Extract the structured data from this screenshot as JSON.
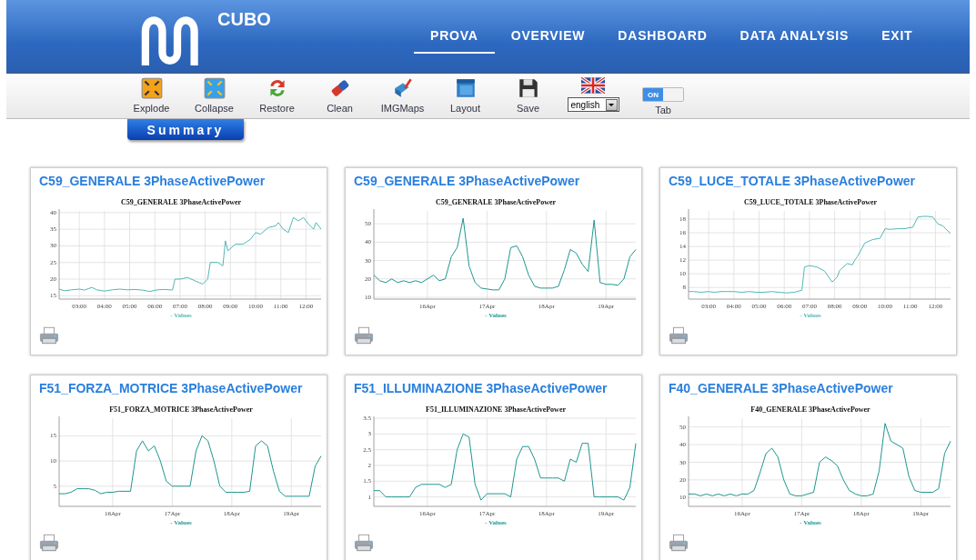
{
  "header": {
    "logo_text": "CUBO",
    "nav": [
      {
        "label": "PROVA",
        "selected": true
      },
      {
        "label": "OVERVIEW",
        "selected": false
      },
      {
        "label": "DASHBOARD",
        "selected": false
      },
      {
        "label": "DATA ANALYSIS",
        "selected": false
      },
      {
        "label": "EXIT",
        "selected": false
      }
    ]
  },
  "toolbar": {
    "buttons": [
      {
        "kind": "explode",
        "label": "Explode"
      },
      {
        "kind": "collapse",
        "label": "Collapse"
      },
      {
        "kind": "restore",
        "label": "Restore"
      },
      {
        "kind": "clean",
        "label": "Clean"
      },
      {
        "kind": "imgmaps",
        "label": "IMGMaps"
      },
      {
        "kind": "layout",
        "label": "Layout"
      },
      {
        "kind": "save",
        "label": "Save"
      }
    ],
    "language": {
      "value": "english"
    },
    "toggle": {
      "on": true,
      "text": "ON",
      "label": "Tab"
    }
  },
  "summary_tab": {
    "label": "Summary"
  },
  "cards": [
    {
      "title": "C59_GENERALE 3PhaseActivePower",
      "chart_data": {
        "type": "line",
        "grid": true,
        "title": "C59_GENERALE 3PhaseActivePower",
        "xlim": [
          2.2,
          12.6
        ],
        "ylim": [
          14,
          40.5
        ],
        "yticks": [
          15,
          20,
          25,
          30,
          35,
          40
        ],
        "xticks": [
          {
            "value": 3,
            "label": "03:00"
          },
          {
            "value": 4,
            "label": "04:00"
          },
          {
            "value": 5,
            "label": "05:00"
          },
          {
            "value": 6,
            "label": "06:00"
          },
          {
            "value": 7,
            "label": "07:00"
          },
          {
            "value": 8,
            "label": "08:00"
          },
          {
            "value": 9,
            "label": "09:00"
          },
          {
            "value": 10,
            "label": "10:00"
          },
          {
            "value": 11,
            "label": "11:00"
          },
          {
            "value": 12,
            "label": "12:00"
          }
        ],
        "x": [
          2.2,
          2.4,
          2.7,
          3.0,
          3.2,
          3.5,
          3.7,
          4.0,
          4.3,
          4.6,
          4.9,
          5.2,
          5.5,
          5.8,
          6.1,
          6.4,
          6.7,
          6.8,
          7.0,
          7.3,
          7.6,
          7.9,
          8.1,
          8.2,
          8.5,
          8.7,
          8.8,
          8.9,
          9.2,
          9.5,
          9.8,
          10.0,
          10.2,
          10.5,
          10.8,
          10.9,
          11.1,
          11.3,
          11.5,
          11.7,
          11.9,
          12.1,
          12.3,
          12.4,
          12.6
        ],
        "series": [
          {
            "name": "- Values",
            "color": "#52b8b4",
            "values": [
              17,
              16.5,
              16.8,
              17,
              16.7,
              17.5,
              16.8,
              16.4,
              16.8,
              17,
              16.8,
              16.9,
              16.7,
              16.3,
              16.8,
              16.9,
              16.7,
              20,
              20,
              20.5,
              19.5,
              18.5,
              20,
              25,
              25,
              24,
              31.5,
              28.5,
              30.5,
              30.5,
              32,
              34,
              33.5,
              35.5,
              36,
              37,
              35,
              34,
              38.5,
              37.5,
              38.5,
              36.5,
              35,
              37,
              35
            ]
          }
        ]
      }
    },
    {
      "title": "C59_GENERALE 3PhaseActivePower",
      "chart_data": {
        "type": "line",
        "grid": true,
        "title": "C59_GENERALE 3PhaseActivePower",
        "ylim": [
          9,
          57
        ],
        "yticks": [
          10,
          20,
          30,
          40,
          50
        ],
        "categories": [
          null,
          null,
          null,
          null,
          null,
          null,
          null,
          null,
          null,
          "16Apr",
          null,
          null,
          null,
          null,
          null,
          null,
          null,
          null,
          null,
          "17Apr",
          null,
          null,
          null,
          null,
          null,
          null,
          null,
          null,
          null,
          "18Apr",
          null,
          null,
          null,
          null,
          null,
          null,
          null,
          null,
          null,
          "19Apr",
          null,
          null,
          null,
          null,
          null
        ],
        "series": [
          {
            "name": "- Values",
            "color": "#1f9690",
            "values": [
              22,
              19,
              18,
              20,
              18,
              19,
              18,
              19,
              18,
              20,
              22,
              19,
              20,
              32,
              37,
              53,
              27,
              18,
              15,
              14.5,
              14,
              14,
              20,
              37,
              38,
              32,
              22,
              16,
              15,
              15,
              15,
              16,
              25,
              36,
              34,
              28,
              24,
              52,
              18,
              17,
              17,
              16.5,
              20,
              32,
              36
            ]
          }
        ]
      }
    },
    {
      "title": "C59_LUCE_TOTALE 3PhaseActivePower",
      "chart_data": {
        "type": "line",
        "grid": true,
        "title": "C59_LUCE_TOTALE 3PhaseActivePower",
        "xlim": [
          2.2,
          12.6
        ],
        "ylim": [
          6.3,
          19.2
        ],
        "yticks": [
          8,
          10,
          12,
          14,
          16,
          18
        ],
        "xticks": [
          {
            "value": 3,
            "label": "03:00"
          },
          {
            "value": 4,
            "label": "04:00"
          },
          {
            "value": 5,
            "label": "05:00"
          },
          {
            "value": 6,
            "label": "06:00"
          },
          {
            "value": 7,
            "label": "07:00"
          },
          {
            "value": 8,
            "label": "08:00"
          },
          {
            "value": 9,
            "label": "09:00"
          },
          {
            "value": 10,
            "label": "10:00"
          },
          {
            "value": 11,
            "label": "11:00"
          },
          {
            "value": 12,
            "label": "12:00"
          }
        ],
        "x": [
          2.2,
          2.4,
          2.7,
          3.0,
          3.2,
          3.5,
          3.7,
          4.0,
          4.3,
          4.6,
          4.9,
          5.2,
          5.5,
          5.8,
          6.1,
          6.4,
          6.7,
          6.8,
          7.0,
          7.3,
          7.6,
          7.9,
          8.1,
          8.2,
          8.5,
          8.7,
          8.8,
          8.9,
          9.2,
          9.5,
          9.8,
          10.0,
          10.2,
          10.5,
          10.8,
          10.9,
          11.1,
          11.3,
          11.5,
          11.7,
          11.9,
          12.1,
          12.3,
          12.4,
          12.6
        ],
        "series": [
          {
            "name": "- Values",
            "color": "#52b8b4",
            "values": [
              7.4,
              7.4,
              7.3,
              7.4,
              7.3,
              7.4,
              7.4,
              7.4,
              7.3,
              7.4,
              7.3,
              7.3,
              7.4,
              7.3,
              7.2,
              7.3,
              7.6,
              11,
              11.2,
              11,
              10.4,
              8.8,
              9.5,
              10.5,
              11.5,
              11.3,
              12,
              12.5,
              14.5,
              15,
              15.2,
              16.6,
              16.5,
              16.6,
              16.6,
              16.7,
              16.8,
              18.3,
              18.4,
              18.4,
              18.3,
              17.3,
              17,
              16.6,
              15.9
            ]
          }
        ]
      }
    },
    {
      "title": "F51_FORZA_MOTRICE 3PhaseActivePower",
      "chart_data": {
        "type": "line",
        "grid": true,
        "title": "F51_FORZA_MOTRICE 3PhaseActivePower",
        "ylim": [
          1,
          18.5
        ],
        "yticks": [
          5,
          10,
          15
        ],
        "categories": [
          null,
          null,
          null,
          null,
          null,
          null,
          null,
          null,
          null,
          "16Apr",
          null,
          null,
          null,
          null,
          null,
          null,
          null,
          null,
          null,
          "17Apr",
          null,
          null,
          null,
          null,
          null,
          null,
          null,
          null,
          null,
          "18Apr",
          null,
          null,
          null,
          null,
          null,
          null,
          null,
          null,
          null,
          "19Apr",
          null,
          null,
          null,
          null,
          null
        ],
        "series": [
          {
            "name": "- Values",
            "color": "#1f9690",
            "values": [
              3.5,
              3.5,
              3.8,
              4.5,
              4.5,
              4.5,
              4.2,
              3.5,
              3.8,
              3.8,
              4,
              4,
              4,
              12,
              14,
              12,
              13,
              10,
              6,
              5,
              5,
              5,
              5,
              12,
              15,
              14,
              10,
              5,
              3.8,
              3.8,
              3.8,
              3.8,
              4,
              13,
              14,
              13,
              8,
              4,
              3,
              3,
              3,
              3,
              3,
              9,
              11
            ]
          }
        ]
      }
    },
    {
      "title": "F51_ILLUMINAZIONE 3PhaseActivePower",
      "chart_data": {
        "type": "line",
        "grid": true,
        "title": "F51_ILLUMINAZIONE 3PhaseActivePower",
        "ylim": [
          0.7,
          3.5
        ],
        "yticks": [
          1,
          1.5,
          2,
          2.5,
          3,
          3.5
        ],
        "categories": [
          null,
          null,
          null,
          null,
          null,
          null,
          null,
          null,
          null,
          "16Apr",
          null,
          null,
          null,
          null,
          null,
          null,
          null,
          null,
          null,
          "17Apr",
          null,
          null,
          null,
          null,
          null,
          null,
          null,
          null,
          null,
          "18Apr",
          null,
          null,
          null,
          null,
          null,
          null,
          null,
          null,
          null,
          "19Apr",
          null,
          null,
          null,
          null,
          null
        ],
        "series": [
          {
            "name": "- Values",
            "color": "#1f9690",
            "values": [
              1.2,
              1.2,
              1.0,
              1.0,
              1.0,
              1.0,
              1.0,
              1.3,
              1.4,
              1.4,
              1.4,
              1.4,
              1.3,
              1.4,
              2.5,
              3.0,
              2.9,
              1.4,
              0.9,
              1.1,
              1.1,
              1.1,
              1.1,
              1.0,
              2.2,
              2.6,
              2.6,
              2.2,
              1.6,
              1.6,
              1.6,
              1.6,
              1.5,
              2.2,
              2.1,
              2.7,
              2.7,
              1.0,
              1.0,
              1.0,
              1.0,
              1.0,
              0.9,
              1.3,
              2.7
            ]
          }
        ]
      }
    },
    {
      "title": "F40_GENERALE 3PhaseActivePower",
      "chart_data": {
        "type": "line",
        "grid": true,
        "title": "F40_GENERALE 3PhaseActivePower",
        "ylim": [
          5,
          55
        ],
        "yticks": [
          10,
          20,
          30,
          40,
          50
        ],
        "categories": [
          null,
          null,
          null,
          null,
          null,
          null,
          null,
          null,
          null,
          "16Apr",
          null,
          null,
          null,
          null,
          null,
          null,
          null,
          null,
          null,
          "17Apr",
          null,
          null,
          null,
          null,
          null,
          null,
          null,
          null,
          null,
          "18Apr",
          null,
          null,
          null,
          null,
          null,
          null,
          null,
          null,
          null,
          "19Apr",
          null,
          null,
          null,
          null,
          null
        ],
        "series": [
          {
            "name": "- Values",
            "color": "#1f9690",
            "values": [
              12,
              12,
              11,
              12,
              11,
              12,
              11,
              12,
              11,
              12,
              12,
              14,
              24,
              35,
              38,
              33,
              20,
              12,
              11,
              11,
              12,
              13,
              30,
              33,
              31,
              28,
              20,
              14,
              12,
              11,
              11,
              12,
              25,
              52,
              42,
              40,
              38,
              22,
              14,
              13,
              13,
              13,
              15,
              35,
              42
            ]
          }
        ]
      }
    }
  ]
}
